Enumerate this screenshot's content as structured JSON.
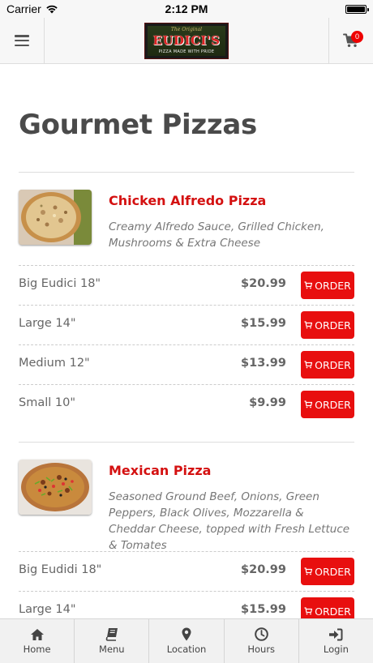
{
  "status_bar": {
    "carrier": "Carrier",
    "time": "2:12 PM"
  },
  "header": {
    "logo": {
      "tagline": "The Original",
      "name": "EUDICI'S",
      "subline": "PIZZA MADE WITH PRIDE"
    },
    "cart_count": "0"
  },
  "page": {
    "title": "Gourmet Pizzas"
  },
  "items": [
    {
      "name": "Chicken Alfredo Pizza",
      "description": "Creamy Alfredo Sauce, Grilled Chicken, Mushrooms & Extra Cheese",
      "sizes": [
        {
          "label": "Big Eudici 18\"",
          "price": "$20.99",
          "button": "ORDER"
        },
        {
          "label": "Large 14\"",
          "price": "$15.99",
          "button": "ORDER"
        },
        {
          "label": "Medium 12\"",
          "price": "$13.99",
          "button": "ORDER"
        },
        {
          "label": "Small 10\"",
          "price": "$9.99",
          "button": "ORDER"
        }
      ]
    },
    {
      "name": "Mexican Pizza",
      "description": "Seasoned Ground Beef, Onions, Green Peppers, Black Olives, Mozzarella & Cheddar Cheese, topped with Fresh Lettuce & Tomates",
      "sizes": [
        {
          "label": "Big Eudidi 18\"",
          "price": "$20.99",
          "button": "ORDER"
        },
        {
          "label": "Large 14\"",
          "price": "$15.99",
          "button": "ORDER"
        }
      ]
    }
  ],
  "tabs": [
    {
      "label": "Home",
      "icon": "home-icon"
    },
    {
      "label": "Menu",
      "icon": "book-icon"
    },
    {
      "label": "Location",
      "icon": "map-pin-icon"
    },
    {
      "label": "Hours",
      "icon": "clock-icon"
    },
    {
      "label": "Login",
      "icon": "sign-in-icon"
    }
  ],
  "colors": {
    "accent": "#e80f0f",
    "item_name": "#d41111",
    "title": "#4a4a4a"
  }
}
